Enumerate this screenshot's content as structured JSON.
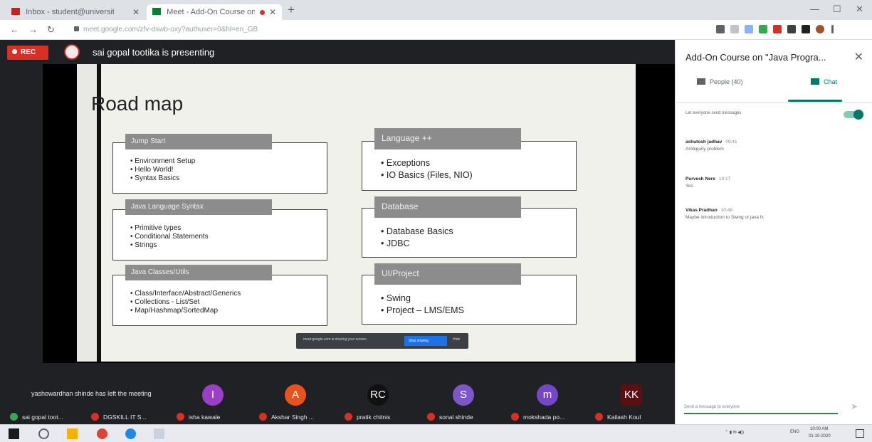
{
  "browser": {
    "tabs": [
      {
        "title": "Inbox - student@university.edu.in"
      },
      {
        "title": "Meet - Add-On Course on"
      }
    ],
    "url": "meet.google.com/zfv-dswb-oxy?authuser=0&hl=en_GB",
    "new_tab": "+",
    "close_glyph": "✕",
    "min_glyph": "—",
    "max_glyph": "☐",
    "back_glyph": "←",
    "forward_glyph": "→",
    "reload_glyph": "↻"
  },
  "meet": {
    "rec_label": "REC",
    "presenter_text": "sai gopal tootika is presenting",
    "share_bar": {
      "text": "meet.google.com is sharing your screen.",
      "stop_label": "Stop sharing",
      "hide_label": "Hide"
    },
    "left_note": "yashowardhan shinde has left the meeting",
    "tiles": [
      {
        "letter": "I",
        "color": "#9c3fc7"
      },
      {
        "letter": "A",
        "color": "#e8521d"
      },
      {
        "letter": "RC",
        "color": "#111111"
      },
      {
        "letter": "S",
        "color": "#7b57c9"
      },
      {
        "letter": "m",
        "color": "#7646c9"
      },
      {
        "letter": "KK",
        "color": "#5a0f12"
      }
    ],
    "participants": [
      {
        "name": "sai gopal toot..."
      },
      {
        "name": "DGSKILL IT S..."
      },
      {
        "name": "isha kawale"
      },
      {
        "name": "Akshar Singh ..."
      },
      {
        "name": "pratik chitnis"
      },
      {
        "name": "sonal shinde"
      },
      {
        "name": "mokshada po..."
      },
      {
        "name": "Kailash Koul"
      }
    ]
  },
  "slide": {
    "title": "Road map",
    "boxes_left": [
      {
        "heading": "Jump Start",
        "items": [
          "Environment Setup",
          "Hello World!",
          "Syntax Basics"
        ]
      },
      {
        "heading": "Java Language Syntax",
        "items": [
          "Primitive types",
          "Conditional Statements",
          "Strings"
        ]
      },
      {
        "heading": "Java Classes/Utils",
        "items": [
          "Class/Interface/Abstract/Generics",
          "Collections - List/Set",
          "Map/Hashmap/SortedMap"
        ]
      }
    ],
    "boxes_right": [
      {
        "heading": "Language ++",
        "items": [
          "Exceptions",
          "IO Basics (Files, NIO)"
        ]
      },
      {
        "heading": "Database",
        "items": [
          "Database Basics",
          "JDBC"
        ]
      },
      {
        "heading": "UI/Project",
        "items": [
          "Swing",
          "Project – LMS/EMS"
        ]
      }
    ]
  },
  "panel": {
    "title": "Add-On Course on \"Java Progra...",
    "close_glyph": "✕",
    "people_tab": "People (40)",
    "chat_tab": "Chat",
    "toggle_label": "Let everyone send messages",
    "messages": [
      {
        "sender": "ashutosh jadhav",
        "time": "09:41",
        "text": "Ambiguity problem"
      },
      {
        "sender": "Purvesh Nere",
        "time": "10:17",
        "text": "Yes"
      },
      {
        "sender": "Vikas Pradhan",
        "time": "10:49",
        "text": "Maybe introduction to Swing or java fx"
      }
    ],
    "input_placeholder": "Send a message to everyone",
    "send_glyph": "➤"
  },
  "taskbar": {
    "tray_lang": "ENG",
    "time": "10:00 AM",
    "date": "01-10-2020"
  },
  "colors": {
    "meet_bg": "#202124",
    "accent": "#00796b",
    "rec": "#d93025"
  }
}
